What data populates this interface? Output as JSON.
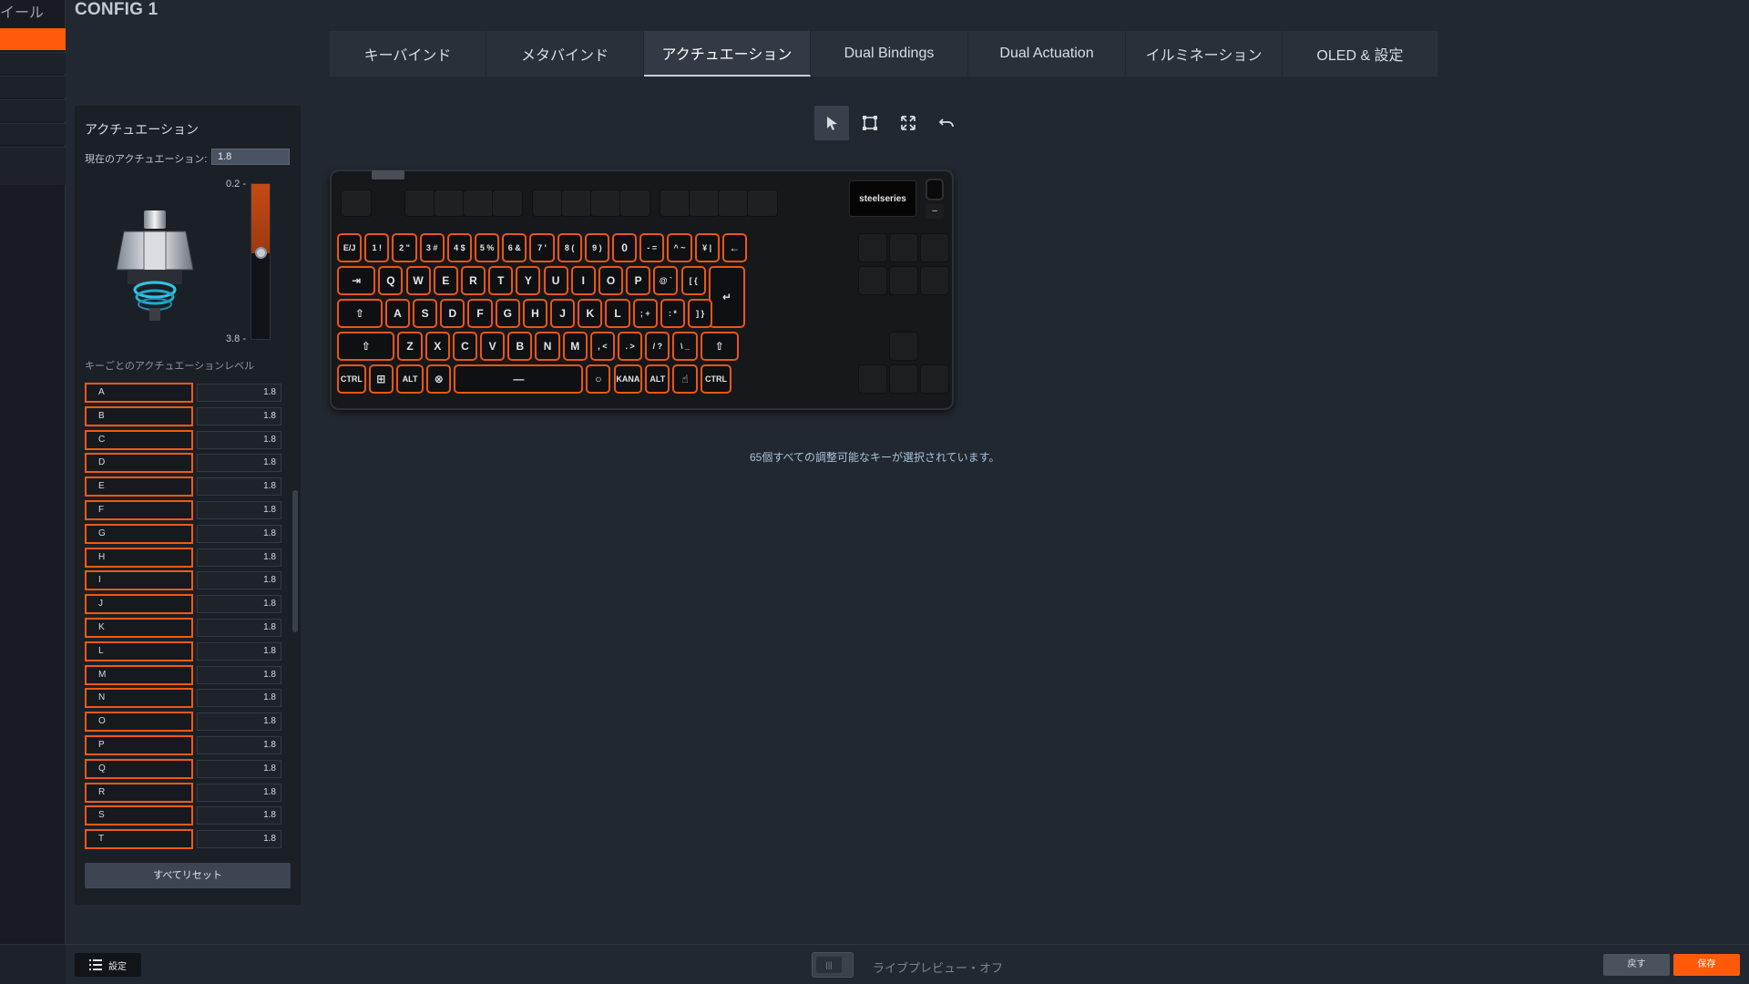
{
  "app": {
    "sidebar_title": "イール",
    "config_title": "CONFIG 1"
  },
  "tabs": [
    {
      "label": "キーバインド"
    },
    {
      "label": "メタバインド"
    },
    {
      "label": "アクチュエーション",
      "active": true
    },
    {
      "label": "Dual Bindings"
    },
    {
      "label": "Dual Actuation"
    },
    {
      "label": "イルミネーション"
    },
    {
      "label": "OLED & 設定"
    }
  ],
  "panel": {
    "title": "アクチュエーション",
    "current_label": "現在のアクチュエーション:",
    "current_value": "1.8",
    "scale_min": "0.2 -",
    "scale_max": "3.8 -",
    "per_key_label": "キーごとのアクチュエーションレベル",
    "reset_label": "すべてリセット",
    "level_fraction": 0.44,
    "keys": [
      {
        "name": "A",
        "value": "1.8"
      },
      {
        "name": "B",
        "value": "1.8"
      },
      {
        "name": "C",
        "value": "1.8"
      },
      {
        "name": "D",
        "value": "1.8"
      },
      {
        "name": "E",
        "value": "1.8"
      },
      {
        "name": "F",
        "value": "1.8"
      },
      {
        "name": "G",
        "value": "1.8"
      },
      {
        "name": "H",
        "value": "1.8"
      },
      {
        "name": "I",
        "value": "1.8"
      },
      {
        "name": "J",
        "value": "1.8"
      },
      {
        "name": "K",
        "value": "1.8"
      },
      {
        "name": "L",
        "value": "1.8"
      },
      {
        "name": "M",
        "value": "1.8"
      },
      {
        "name": "N",
        "value": "1.8"
      },
      {
        "name": "O",
        "value": "1.8"
      },
      {
        "name": "P",
        "value": "1.8"
      },
      {
        "name": "Q",
        "value": "1.8"
      },
      {
        "name": "R",
        "value": "1.8"
      },
      {
        "name": "S",
        "value": "1.8"
      },
      {
        "name": "T",
        "value": "1.8"
      }
    ]
  },
  "toolbar": {
    "icons": [
      "select-arrow-icon",
      "box-select-icon",
      "expand-select-icon",
      "undo-icon"
    ]
  },
  "keyboard": {
    "brand": "steelseries",
    "dial_button": "–",
    "rows": [
      [
        "E/J",
        "1 !",
        "2 \"",
        "3 #",
        "4 $",
        "5 %",
        "6 &",
        "7 '",
        "8 (",
        "9 )",
        "0",
        "- =",
        "^ ~",
        "¥ |",
        "←"
      ],
      [
        "⇥",
        "Q",
        "W",
        "E",
        "R",
        "T",
        "Y",
        "U",
        "I",
        "O",
        "P",
        "@ `",
        "[ {",
        "↵"
      ],
      [
        "⇧",
        "A",
        "S",
        "D",
        "F",
        "G",
        "H",
        "J",
        "K",
        "L",
        "; +",
        ": *",
        "] }"
      ],
      [
        "⇧",
        "Z",
        "X",
        "C",
        "V",
        "B",
        "N",
        "M",
        ", <",
        ". >",
        "/ ?",
        "\\ _",
        "⇧"
      ],
      [
        "CTRL",
        "⊞",
        "ALT",
        "⊗",
        "—",
        "○",
        "KANA",
        "ALT",
        "☝",
        "CTRL"
      ]
    ]
  },
  "status_message": "65個すべての調整可能なキーが選択されています。",
  "bottom": {
    "settings_label": "設定",
    "live_preview_label": "ライブプレビュー・オフ",
    "back_label": "戻す",
    "save_label": "保存"
  },
  "colors": {
    "accent": "#ff5a0a",
    "key_border": "#e8561a",
    "background": "#222831"
  }
}
